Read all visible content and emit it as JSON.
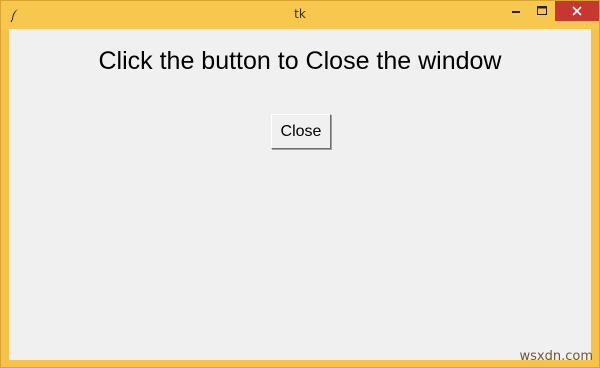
{
  "window": {
    "title": "tk",
    "frame_color": "#f6c24a",
    "client_bg": "#f0f0f0",
    "close_control_color": "#c7372f",
    "icons": {
      "app": "feather-icon",
      "minimize": "minimize-icon",
      "maximize": "maximize-icon",
      "close": "close-icon"
    }
  },
  "content": {
    "heading": "Click the button to Close the window",
    "button_label": "Close"
  },
  "watermark": "wsxdn.com"
}
